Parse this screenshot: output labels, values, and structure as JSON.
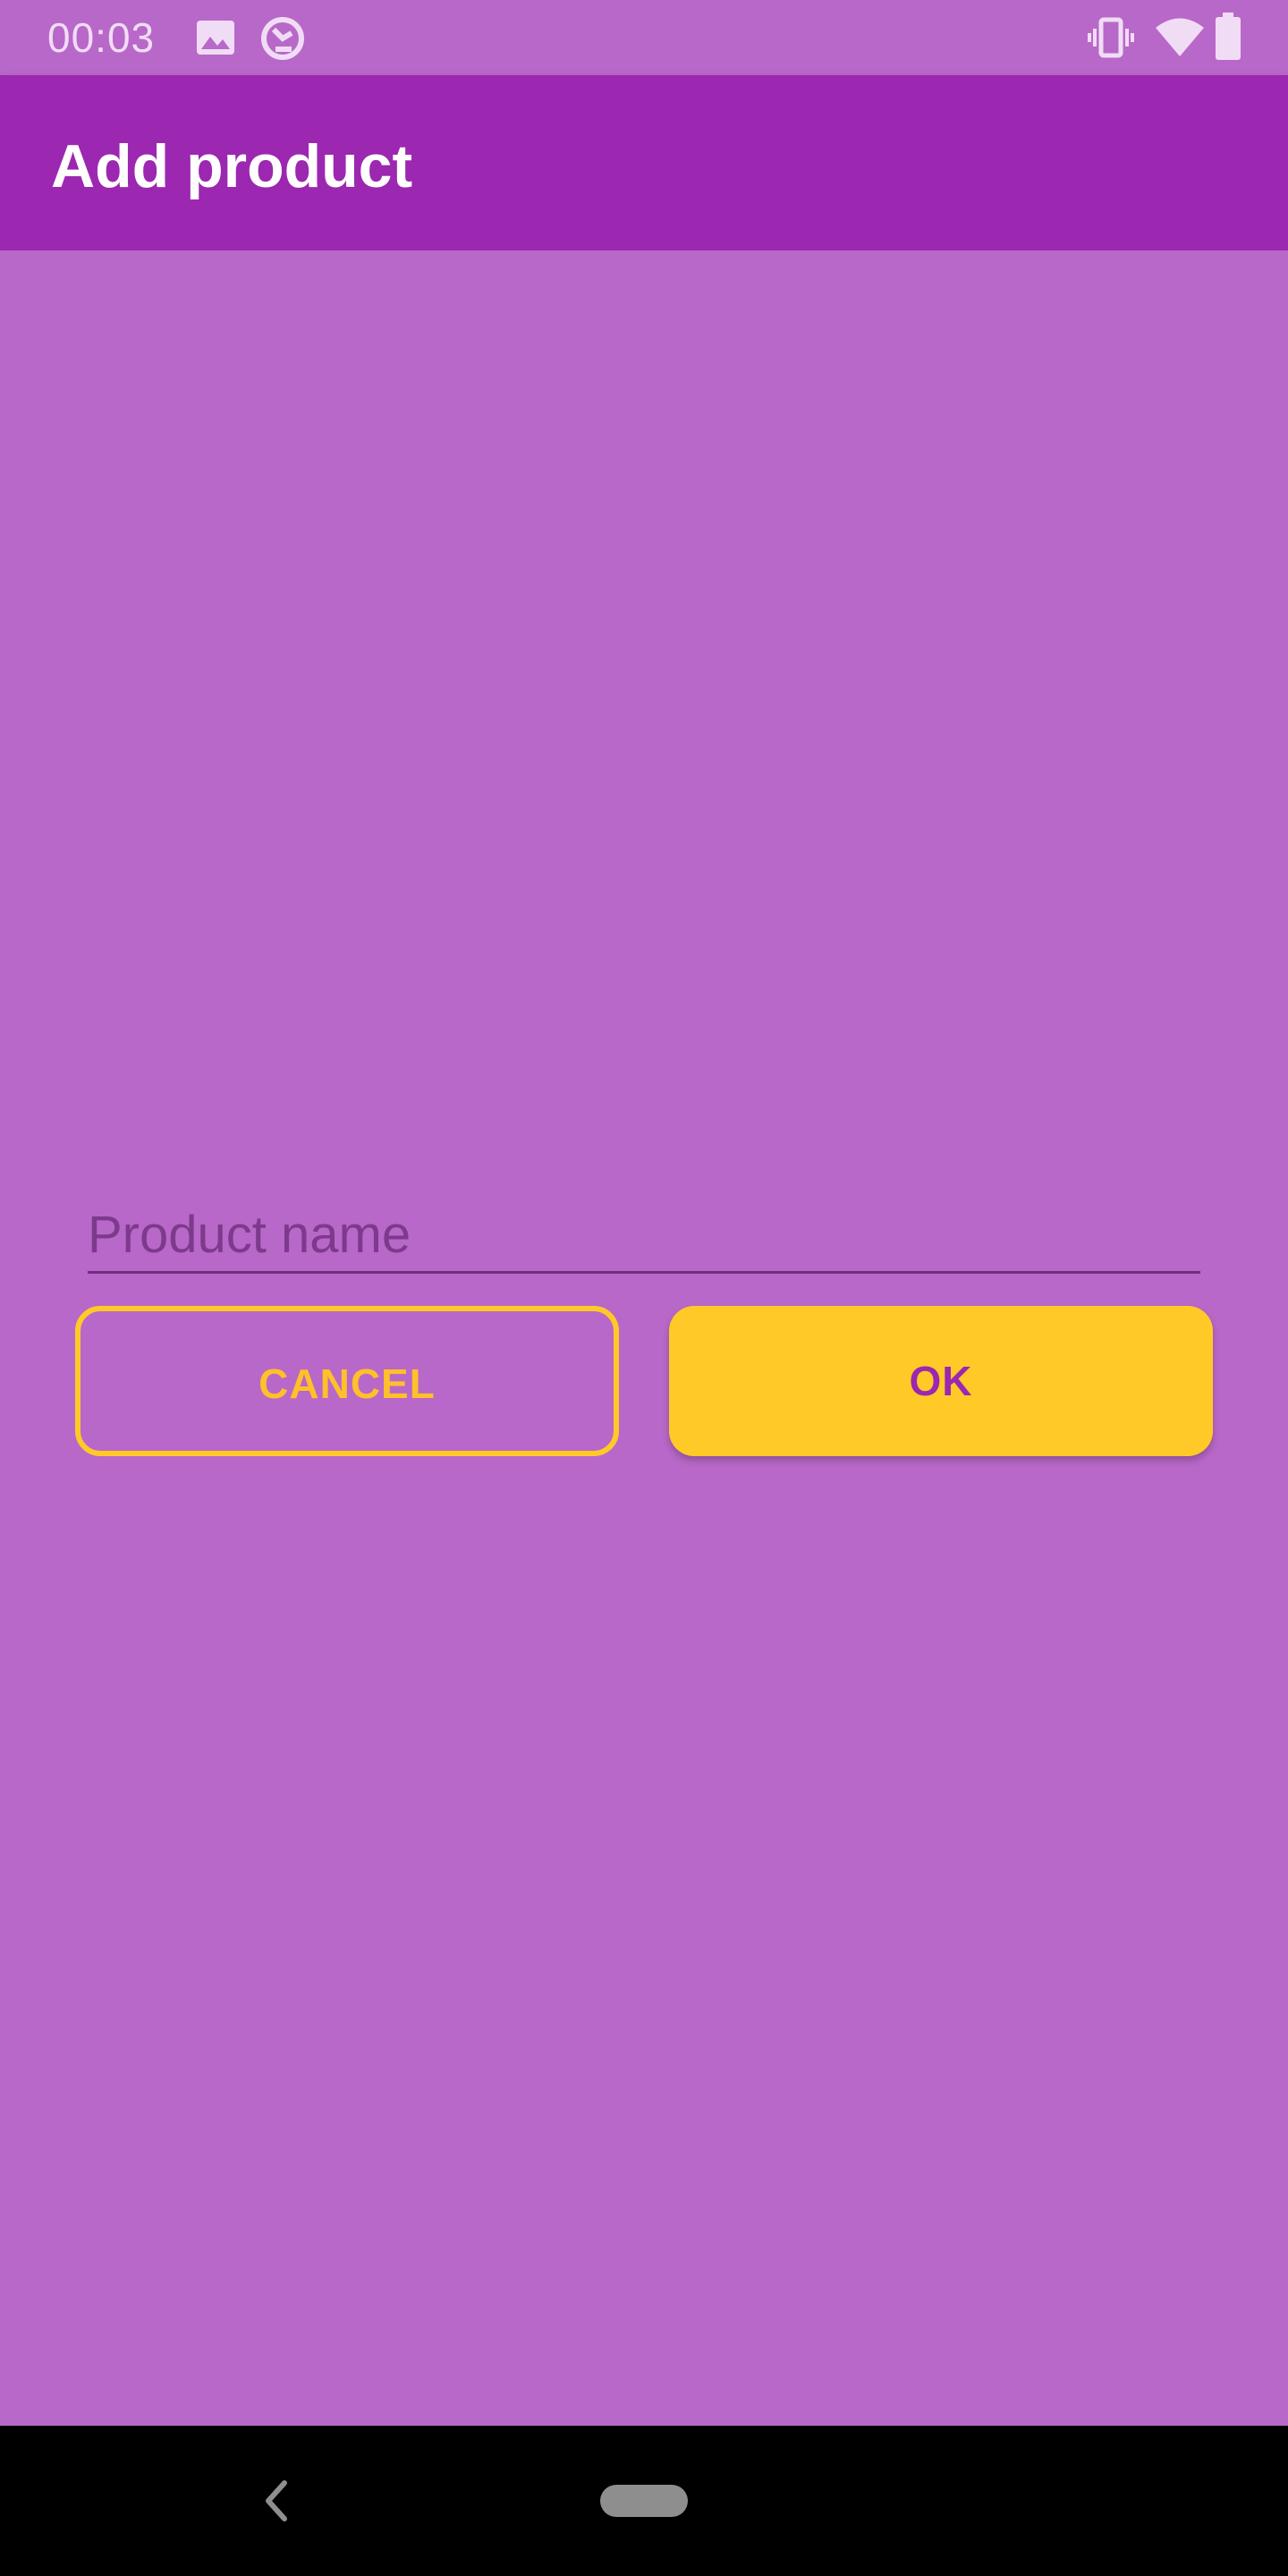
{
  "status_bar": {
    "time": "00:03",
    "icons": [
      "image-icon",
      "sync-disabled-icon",
      "vibrate-icon",
      "wifi-icon",
      "battery-icon"
    ]
  },
  "app_bar": {
    "title": "Add product",
    "color": "#9c27b0"
  },
  "form": {
    "product_name": {
      "placeholder": "Product name",
      "value": ""
    },
    "cancel_label": "CANCEL",
    "ok_label": "OK",
    "accent_color": "#ffca28"
  },
  "navigation": {
    "icons": [
      "back-icon",
      "home-pill-icon"
    ]
  },
  "colors": {
    "background": "#b868c8",
    "primary": "#9c27b0",
    "accent": "#ffca28"
  }
}
